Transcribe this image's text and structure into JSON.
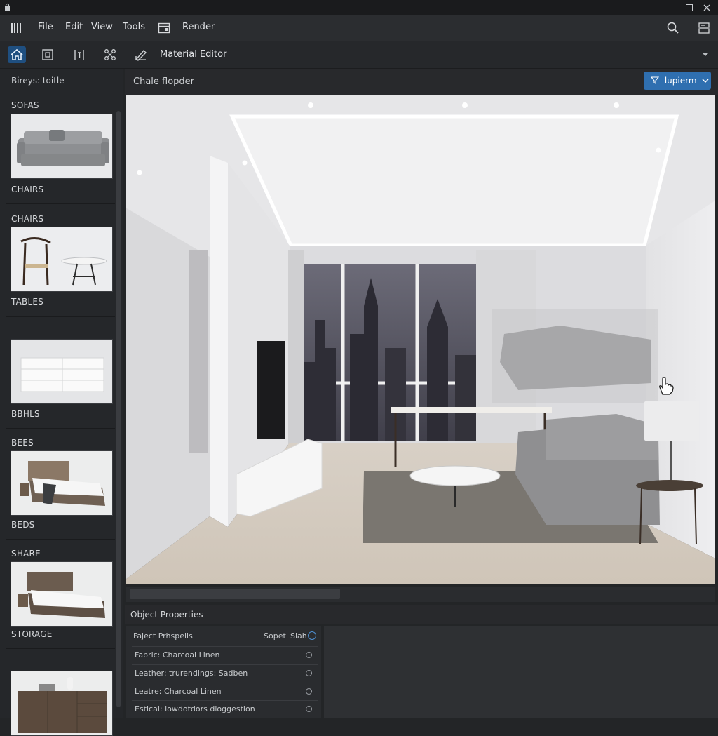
{
  "menubar": {
    "items": [
      "File",
      "Edit",
      "View",
      "Tools",
      "Render"
    ]
  },
  "toolbar": {
    "material_editor_label": "Material Editor"
  },
  "sidebar": {
    "title": "Bireys: toitle",
    "categories": [
      {
        "heading": "SOFAS",
        "footer": "CHAIRS"
      },
      {
        "heading": "CHAIRS",
        "footer": "TABLES"
      },
      {
        "heading": "",
        "footer": "BBHLS"
      },
      {
        "heading": "BEES",
        "footer": "BEDS"
      },
      {
        "heading": "SHARE",
        "footer": "STORAGE"
      },
      {
        "heading": "",
        "footer": ""
      }
    ]
  },
  "viewport": {
    "header_label": "Chale flopder",
    "render_dropdown_label": "lupierm"
  },
  "properties": {
    "panel_title": "Object Properties",
    "col_a": "Faject Prhspeils",
    "col_b": "Sopet",
    "col_c": "Slah",
    "rows": [
      "Fabric: Charcoal Linen",
      "Leather: trurendings: Sadben",
      "Leatre: Charcoal Linen",
      "Estical: lowdotdors dioggestion"
    ]
  },
  "colors": {
    "accent": "#2f6fb0",
    "panel_bg": "#25272a",
    "text": "#d6d8db"
  },
  "icons": {
    "app_logo": "vertical-bars-icon",
    "search": "search-icon",
    "settings": "panel-settings-icon",
    "home": "home-icon",
    "render_preview": "render-frame-icon"
  }
}
